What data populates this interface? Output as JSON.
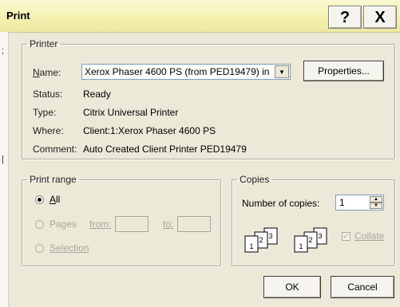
{
  "window": {
    "title": "Print",
    "help_glyph": "?",
    "close_glyph": "X"
  },
  "left_edge": {
    "glyph_top": ";",
    "glyph_bottom": "|"
  },
  "printer": {
    "legend": "Printer",
    "name_label": "Name:",
    "name_value": "Xerox Phaser 4600 PS (from PED19479) in",
    "properties_label": "Properties...",
    "status_label": "Status:",
    "status_value": "Ready",
    "type_label": "Type:",
    "type_value": "Citrix Universal Printer",
    "where_label": "Where:",
    "where_value": "Client:1:Xerox Phaser 4600 PS",
    "comment_label": "Comment:",
    "comment_value": "Auto Created Client Printer PED19479"
  },
  "print_range": {
    "legend": "Print range",
    "all_label": "All",
    "pages_label": "Pages",
    "from_label": "from:",
    "to_label": "to:",
    "selection_label": "Selection",
    "selected": "All"
  },
  "copies": {
    "legend": "Copies",
    "number_label": "Number of copies:",
    "number_value": "1",
    "collate_label": "Collate",
    "collate_checked": true,
    "page_labels": [
      "1",
      "2",
      "3"
    ]
  },
  "footer": {
    "ok_label": "OK",
    "cancel_label": "Cancel"
  }
}
